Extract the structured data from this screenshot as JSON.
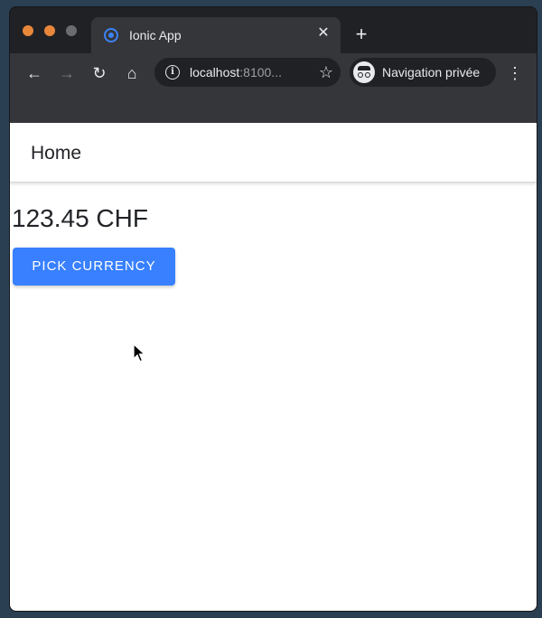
{
  "browser": {
    "tab": {
      "title": "Ionic App",
      "close_glyph": "✕"
    },
    "new_tab_glyph": "+",
    "toolbar": {
      "back_glyph": "←",
      "forward_glyph": "→",
      "reload_glyph": "↻",
      "home_glyph": "⌂",
      "url_host": "localhost",
      "url_rest": ":8100...",
      "info_glyph": "i",
      "star_glyph": "☆",
      "incognito_label": "Navigation privée",
      "menu_glyph": "⋮"
    },
    "window_controls": [
      "close",
      "minimize",
      "maximize"
    ],
    "accent_colors": {
      "close": "#e9873b",
      "minimize": "#e9873b",
      "maximize": "#6b6c70"
    }
  },
  "app": {
    "header": {
      "title": "Home"
    },
    "amount": "123.45 CHF",
    "pick_button_label": "PICK CURRENCY",
    "primary_color": "#3880ff"
  },
  "icons": {
    "favicon": "ionic-icon",
    "incognito": "incognito-icon",
    "cursor": "mouse-pointer-icon"
  }
}
